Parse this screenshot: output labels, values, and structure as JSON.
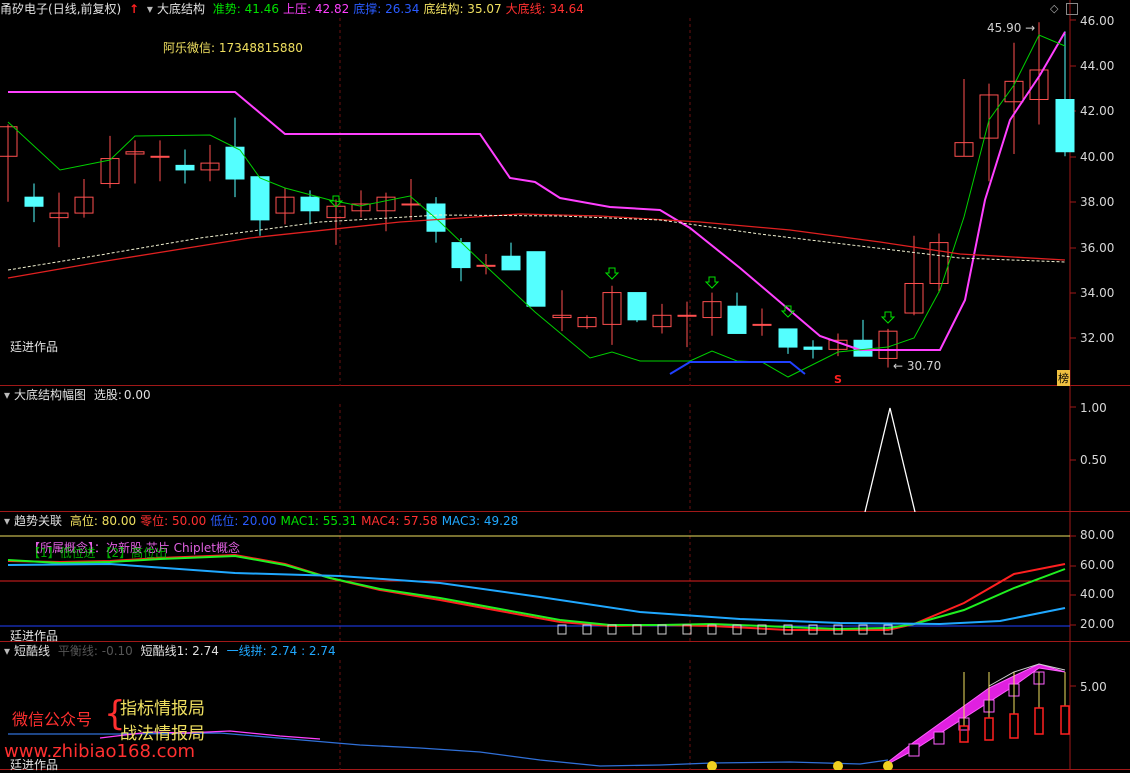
{
  "main": {
    "symbol": "甬矽电子",
    "period": "(日线,前复权)",
    "arrow": "↑",
    "indicator": "大底结构",
    "stats": [
      {
        "label": "准势:",
        "value": "41.46",
        "color": "#00e000"
      },
      {
        "label": "上压:",
        "value": "42.82",
        "color": "#ff40ff"
      },
      {
        "label": "底撑:",
        "value": "26.34",
        "color": "#2a5bff"
      },
      {
        "label": "底结构:",
        "value": "35.07",
        "color": "#f0e060"
      },
      {
        "label": "大底线:",
        "value": "34.64",
        "color": "#ff3030"
      }
    ],
    "wechat": "阿乐微信: 17348815880",
    "author": "廷进作品",
    "high_label": "45.90",
    "low_label": "30.70",
    "signal_s": "S",
    "badge": "榜",
    "yticks": [
      "46.00",
      "44.00",
      "42.00",
      "40.00",
      "38.00",
      "36.00",
      "34.00",
      "32.00"
    ]
  },
  "pane2": {
    "title": "大底结构幅图",
    "stat_label": "选股:",
    "stat_value": "0.00",
    "yticks": [
      "1.00",
      "0.50"
    ]
  },
  "pane3": {
    "title": "趋势关联",
    "stats": [
      {
        "label": "高位:",
        "value": "80.00",
        "color": "#f0e060"
      },
      {
        "label": "零位:",
        "value": "50.00",
        "color": "#ff3030"
      },
      {
        "label": "低位:",
        "value": "20.00",
        "color": "#2a5bff"
      },
      {
        "label": "MAC1:",
        "value": "55.31",
        "color": "#00e000"
      },
      {
        "label": "MAC4:",
        "value": "57.58",
        "color": "#ff3030"
      },
      {
        "label": "MAC3:",
        "value": "49.28",
        "color": "#20a8ff"
      }
    ],
    "concept": "【所属概念】：次新股 芯片 Chiplet概念",
    "legend": "【1】低位进  【2】高位出",
    "author": "廷进作品",
    "yticks": [
      "80.00",
      "60.00",
      "40.00",
      "20.00"
    ]
  },
  "pane4": {
    "title": "短酷线",
    "faded": "平衡线: -0.10",
    "stat1": "短酷线1: 2.74",
    "stat2": "一线拼: 2.74 : 2.74",
    "wm_label": "微信公众号",
    "wm_1": "指标情报局",
    "wm_2": "战法情报局",
    "site": "www.zhibiao168.com",
    "author": "廷进作品",
    "yticks": [
      "5.00"
    ]
  }
}
